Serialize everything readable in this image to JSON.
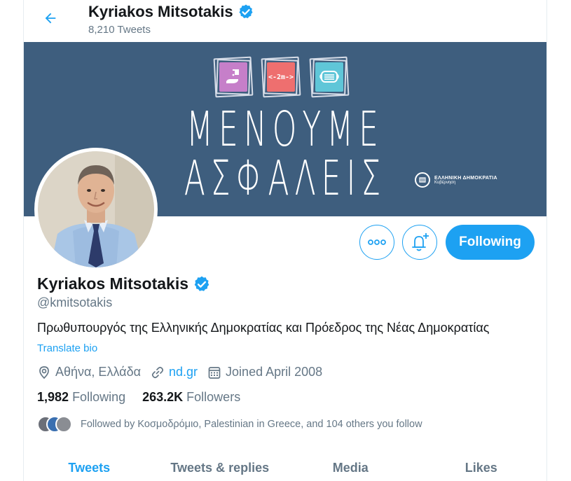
{
  "header": {
    "title": "Kyriakos Mitsotakis",
    "tweet_count": "8,210 Tweets"
  },
  "banner": {
    "line1": "ΜΕΝΟΥΜΕ",
    "line2": "ΑΣΦΑΛΕΙΣ",
    "tiles": [
      {
        "icon": "hand-sanitizer-icon",
        "color": "#c67fc9"
      },
      {
        "icon": "distance-arrows-icon",
        "color": "#ee6f6f",
        "label": "<-2m->"
      },
      {
        "icon": "face-mask-icon",
        "color": "#5fc6d8"
      }
    ],
    "gov_line1": "ΕΛΛΗΝΙΚΗ ΔΗΜΟΚΡΑΤΙΑ",
    "gov_line2": "Κυβέρνηση"
  },
  "actions": {
    "more_icon": "more-icon",
    "notify_icon": "bell-plus-icon",
    "follow_label": "Following"
  },
  "profile": {
    "name": "Kyriakos Mitsotakis",
    "handle": "@kmitsotakis",
    "bio": "Πρωθυπουργός της Ελληνικής Δημοκρατίας και Πρόεδρος της Νέας Δημοκρατίας",
    "translate_label": "Translate bio",
    "location": "Αθήνα, Ελλάδα",
    "website": "nd.gr",
    "joined": "Joined April 2008",
    "following_count": "1,982",
    "following_label": "Following",
    "followers_count": "263.2K",
    "followers_label": "Followers",
    "followed_by": "Followed by Κοσμοδρόμιο, Palestinian in Greece, and 104 others you follow"
  },
  "tabs": [
    {
      "label": "Tweets",
      "active": true
    },
    {
      "label": "Tweets & replies",
      "active": false
    },
    {
      "label": "Media",
      "active": false
    },
    {
      "label": "Likes",
      "active": false
    }
  ],
  "colors": {
    "accent": "#1da1f2",
    "banner_bg": "#3e5e7e",
    "secondary_text": "#657786"
  }
}
